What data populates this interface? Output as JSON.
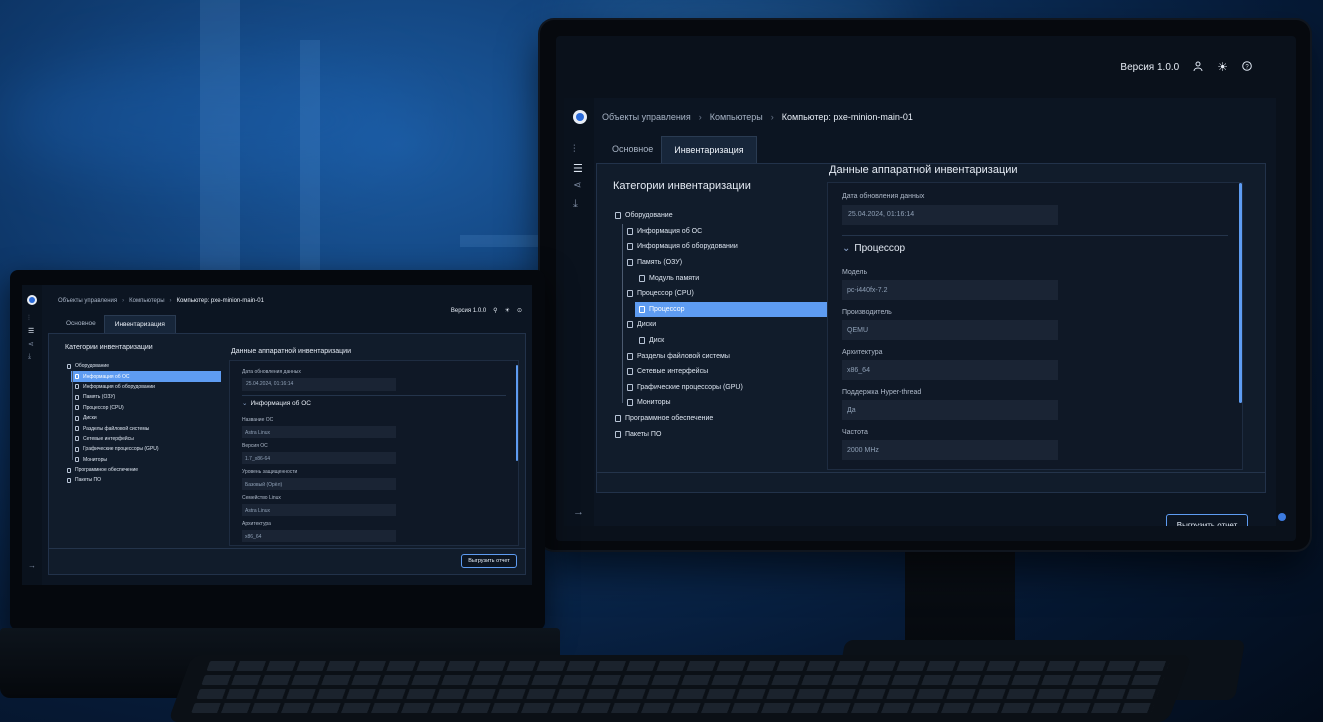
{
  "monitor": {
    "header_right": {
      "version": "Версия 1.0.0"
    },
    "breadcrumb": [
      "Объекты управления",
      "Компьютеры",
      "Компьютер: pxe-minion-main-01"
    ],
    "tabs": [
      "Основное",
      "Инвентаризация"
    ],
    "tree_title": "Категории инвентаризации",
    "tree": [
      "Оборудование",
      "Информация об ОС",
      "Информация об оборудовании",
      "Память (ОЗУ)",
      "Модуль памяти",
      "Процессор (CPU)",
      "Процессор",
      "Диски",
      "Диск",
      "Разделы файловой системы",
      "Сетевые интерфейсы",
      "Графические процессоры (GPU)",
      "Мониторы",
      "Программное обеспечение",
      "Пакеты ПО"
    ],
    "detail_title": "Данные аппаратной инвентаризации",
    "updated_label": "Дата обновления данных",
    "updated_value": "25.04.2024, 01:16:14",
    "section": "Процессор",
    "fields": [
      {
        "label": "Модель",
        "value": "pc-i440fx-7.2"
      },
      {
        "label": "Производитель",
        "value": "QEMU"
      },
      {
        "label": "Архитектура",
        "value": "x86_64"
      },
      {
        "label": "Поддержка Hyper-thread",
        "value": "Да"
      },
      {
        "label": "Частота",
        "value": "2000 MHz"
      }
    ],
    "export_button": "Выгрузить отчет"
  },
  "laptop": {
    "header_right": {
      "version": "Версия 1.0.0"
    },
    "breadcrumb": [
      "Объекты управления",
      "Компьютеры",
      "Компьютер: pxe-minion-main-01"
    ],
    "tabs": [
      "Основное",
      "Инвентаризация"
    ],
    "tree_title": "Категории инвентаризации",
    "tree": [
      "Оборудование",
      "Информация об ОС",
      "Информация об оборудовании",
      "Память (ОЗУ)",
      "Процессор (CPU)",
      "Диски",
      "Разделы файловой системы",
      "Сетевые интерфейсы",
      "Графические процессоры (GPU)",
      "Мониторы",
      "Программное обеспечение",
      "Пакеты ПО"
    ],
    "detail_title": "Данные аппаратной инвентаризации",
    "updated_label": "Дата обновления данных",
    "updated_value": "25.04.2024, 01:16:14",
    "section": "Информация об ОС",
    "fields": [
      {
        "label": "Название ОС",
        "value": "Astra Linux"
      },
      {
        "label": "Версия ОС",
        "value": "1.7_x86-64"
      },
      {
        "label": "Уровень защищенности",
        "value": "Базовый (Орёл)"
      },
      {
        "label": "Семейство Linux",
        "value": "Astra Linux"
      },
      {
        "label": "Архитектура",
        "value": "x86_64"
      }
    ],
    "export_button": "Выгрузить отчет"
  },
  "icons": {
    "logo": "app-logo-icon",
    "user": "user-icon",
    "theme": "sun-icon",
    "help": "help-icon",
    "settings": "sliders-icon",
    "list": "list-icon",
    "share": "share-icon",
    "download": "download-icon",
    "collapse": "arrow-right-icon",
    "doc": "document-icon",
    "chevron": "chevron-down-icon"
  },
  "colors": {
    "accent": "#5e9cf2",
    "background": "#0c1522"
  }
}
